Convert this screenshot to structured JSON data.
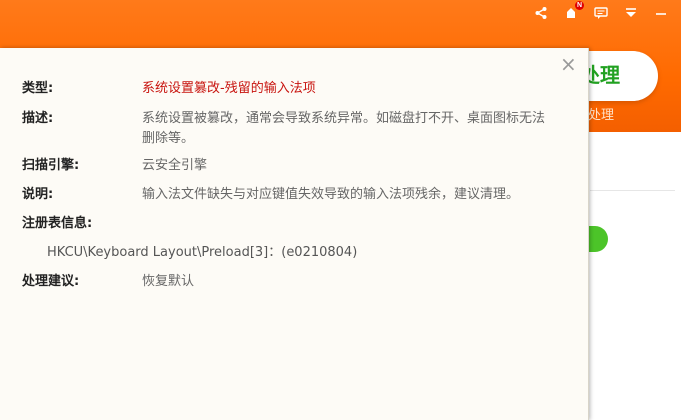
{
  "background": {
    "primary_action_label": "处理",
    "sub_text": "处理"
  },
  "topbar": {
    "icons": [
      "share-icon",
      "notification-icon",
      "message-icon",
      "menu-icon",
      "minimize-icon"
    ],
    "notification_badge": "N"
  },
  "popup": {
    "close_glyph": "×",
    "fields": {
      "type": {
        "label": "类型:",
        "value": "系统设置篡改-残留的输入法项"
      },
      "description": {
        "label": "描述:",
        "value": "系统设置被篡改，通常会导致系统异常。如磁盘打不开、桌面图标无法删除等。"
      },
      "engine": {
        "label": "扫描引擎:",
        "value": "云安全引擎"
      },
      "note": {
        "label": "说明:",
        "value": "输入法文件缺失与对应键值失效导致的输入法项残余，建议清理。"
      },
      "registry": {
        "label": "注册表信息:",
        "value": "HKCU\\Keyboard Layout\\Preload[3]：(e0210804)"
      },
      "suggestion": {
        "label": "处理建议:",
        "value": "恢复默认"
      }
    }
  },
  "colors": {
    "header_orange": "#ff6a00",
    "type_value_red": "#c8140f",
    "action_green": "#21a121",
    "popup_bg": "#fdfbf6"
  }
}
